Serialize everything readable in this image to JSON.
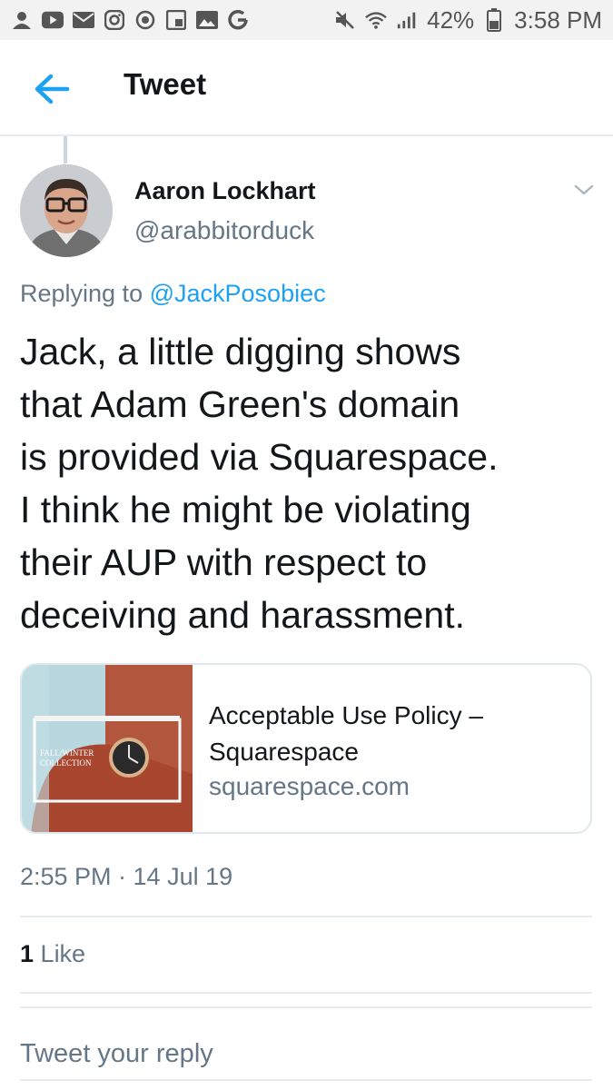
{
  "status_bar": {
    "left_icons": [
      "profile-icon",
      "youtube-icon",
      "mail-icon",
      "instagram-icon",
      "sync-icon",
      "news-icon",
      "gallery-icon",
      "google-icon"
    ],
    "battery_percent": "42%",
    "time": "3:58 PM"
  },
  "header": {
    "title": "Tweet"
  },
  "tweet": {
    "author_name": "Aaron Lockhart",
    "author_handle": "@arabbitorduck",
    "replying_prefix": "Replying to",
    "replying_to": "@JackPosobiec",
    "text_lines": [
      "Jack, a little digging shows",
      "that Adam Green's domain",
      "is provided via Squarespace.",
      "I think he might be violating",
      "their AUP with respect to",
      "deceiving and harassment."
    ],
    "card": {
      "title_lines": [
        "Acceptable Use Policy –",
        "Squarespace"
      ],
      "domain": "squarespace.com",
      "thumb_text": "FALL/WINTER COLLECTION"
    },
    "timestamp": "2:55 PM · 14 Jul 19",
    "likes_count": "1",
    "likes_label": "Like"
  },
  "reply": {
    "placeholder": "Tweet your reply"
  },
  "colors": {
    "accent": "#1da1f2",
    "text_primary": "#14171a",
    "text_secondary": "#657786",
    "divider": "#e6ecf0"
  }
}
